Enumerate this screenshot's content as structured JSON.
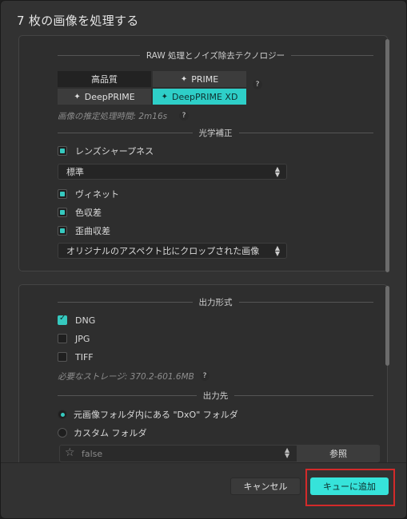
{
  "window": {
    "title": "7 枚の画像を処理する"
  },
  "raw": {
    "header": "RAW 処理とノイズ除去テクノロジー",
    "options": [
      "高品質",
      "PRIME",
      "DeepPRIME",
      "DeepPRIME XD"
    ],
    "selected": "DeepPRIME XD",
    "help": "?",
    "estimate": "画像の推定処理時間: 2m16s",
    "estimate_help": "?"
  },
  "optics": {
    "header": "光学補正",
    "lens_sharpness": "レンズシャープネス",
    "sharpness_select": "標準",
    "vignette": "ヴィネット",
    "chromatic": "色収差",
    "distortion": "歪曲収差",
    "crop_select": "オリジナルのアスペクト比にクロップされた画像"
  },
  "output": {
    "header": "出力形式",
    "dng": "DNG",
    "jpg": "JPG",
    "tiff": "TIFF",
    "storage": "必要なストレージ: 370.2-601.6MB",
    "storage_help": "?"
  },
  "destination": {
    "header": "出力先",
    "original_folder": "元画像フォルダ内にある \"DxO\" フォルダ",
    "custom_folder": "カスタム フォルダ",
    "path_value": "false",
    "browse": "参照"
  },
  "footer": {
    "cancel": "キャンセル",
    "add_to_queue": "キューに追加"
  },
  "colors": {
    "accent": "#36e3da",
    "highlight": "#d32a2a"
  }
}
